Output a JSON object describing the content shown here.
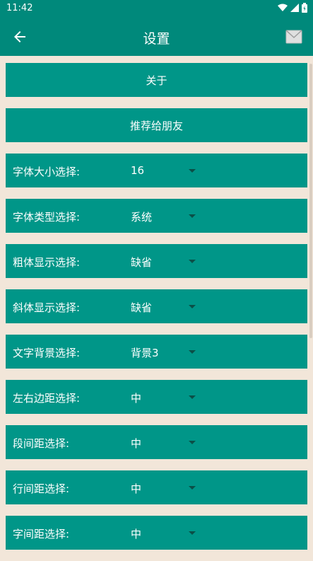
{
  "status_bar": {
    "time": "11:42",
    "icons": [
      "wifi-icon",
      "signal-icon",
      "battery-icon"
    ]
  },
  "app_bar": {
    "title": "设置",
    "back_icon": "arrow-left-icon",
    "mail_icon": "mail-icon"
  },
  "buttons": {
    "about": "关于",
    "recommend": "推荐给朋友"
  },
  "settings": [
    {
      "label": "字体大小选择:",
      "value": "16"
    },
    {
      "label": "字体类型选择:",
      "value": "系统"
    },
    {
      "label": "粗体显示选择:",
      "value": "缺省"
    },
    {
      "label": "斜体显示选择:",
      "value": "缺省"
    },
    {
      "label": "文字背景选择:",
      "value": "背景3"
    },
    {
      "label": "左右边距选择:",
      "value": "中"
    },
    {
      "label": "段间距选择:",
      "value": "中"
    },
    {
      "label": "行间距选择:",
      "value": "中"
    },
    {
      "label": "字间距选择:",
      "value": "中"
    }
  ],
  "colors": {
    "status_bar": "#00897b",
    "primary": "#009688",
    "background": "#f2e6d9",
    "arrow": "#0b4f47"
  }
}
